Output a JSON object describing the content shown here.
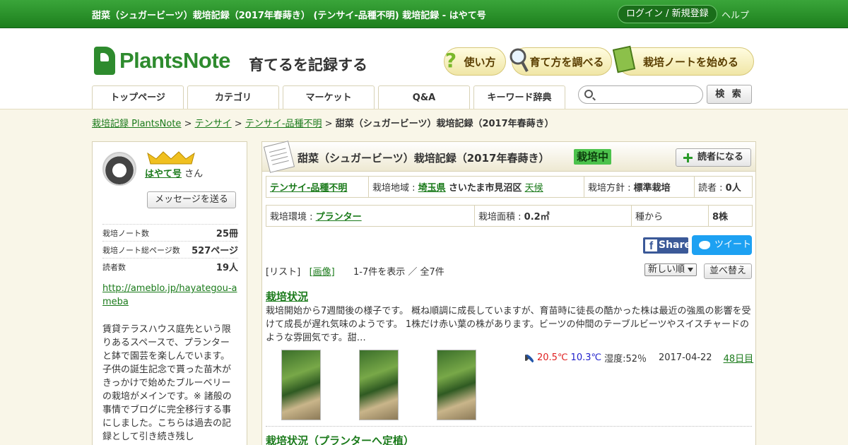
{
  "site": {
    "window_title": "甜菜（シュガービーツ）栽培記録（2017年春蒔き） (テンサイ-品種不明) 栽培記録 - はやて号",
    "login": "ログイン / 新規登録",
    "help": "ヘルプ",
    "logo": "PlantsNote",
    "tagline": "育てるを記録する",
    "header_buttons": [
      "使い方",
      "育て方を調べる",
      "栽培ノートを始める"
    ],
    "header_icons": [
      "question-icon",
      "magnifier-icon",
      "notebook-icon"
    ],
    "accent": "#2e8b2e"
  },
  "nav": {
    "tabs": [
      "トップページ",
      "カテゴリ",
      "マーケット",
      "Q&A",
      "キーワード辞典"
    ],
    "search_placeholder": "",
    "search_button": "検 索"
  },
  "breadcrumb": {
    "items": [
      "栽培記録 PlantsNote",
      "テンサイ",
      "テンサイ-品種不明"
    ],
    "sep": ">",
    "current": "甜菜（シュガービーツ）栽培記録（2017年春蒔き）"
  },
  "sidebar": {
    "username": "はやて号",
    "honorific": "さん",
    "message_button": "メッセージを送る",
    "stats": [
      {
        "label": "栽培ノート数",
        "value": "25冊"
      },
      {
        "label": "栽培ノート総ページ数",
        "value": "527ページ"
      },
      {
        "label": "読者数",
        "value": "19人"
      }
    ],
    "blog_url": "http://ameblo.jp/hayategou-ameba",
    "bio": "賃貸テラスハウス庭先という限りあるスペースで、プランターと鉢で園芸を楽しんでいます。子供の誕生記念で貰った苗木がきっかけで始めたブルーベリーの栽培がメインです。※ 諸般の事情でブログに完全移行する事にしました。こちらは過去の記録として引き続き残し"
  },
  "note": {
    "title": "甜菜（シュガービーツ）栽培記録（2017年春蒔き）",
    "status": "栽培中",
    "follow_button": "読者になる",
    "row1": {
      "variety": "テンサイ-品種不明",
      "region_label": "栽培地域 :",
      "pref": "埼玉県",
      "city": "さいたま市見沼区",
      "weather_link": "天候",
      "policy_label": "栽培方針 :",
      "policy": "標準栽培",
      "readers_label": "読者 :",
      "readers": "0人"
    },
    "row2": {
      "env_label": "栽培環境 :",
      "env": "プランター",
      "area_label": "栽培面積 :",
      "area": "0.2㎡",
      "start": "種から",
      "count": "8株"
    },
    "share_label": "Share",
    "tweet_label": "ツイート",
    "view_list": "[リスト]",
    "view_image": "[画像]",
    "count_text": "1-7件を表示 ／ 全7件",
    "sort_option": "新しい順",
    "sort_button": "並べ替え"
  },
  "entries": [
    {
      "title": "栽培状況",
      "body": "栽培開始から7週間後の様子です。 概ね順調に成長していますが、育苗時に徒長の酷かった株は最近の強風の影響を受けて成長が遅れ気味のようです。 1株だけ赤い葉の株があります。ビーツの仲間のテーブルビーツやスイスチャードのような雰囲気です。甜…",
      "temp_high": "20.5℃",
      "temp_low": "10.3℃",
      "humidity": "湿度:52％",
      "date": "2017-04-22",
      "day": "48日目",
      "weather_icons": [
        "cloud-icon",
        "arrow-icon",
        "rain-icon"
      ]
    },
    {
      "title": "栽培状況（プランターへ定植）"
    }
  ]
}
